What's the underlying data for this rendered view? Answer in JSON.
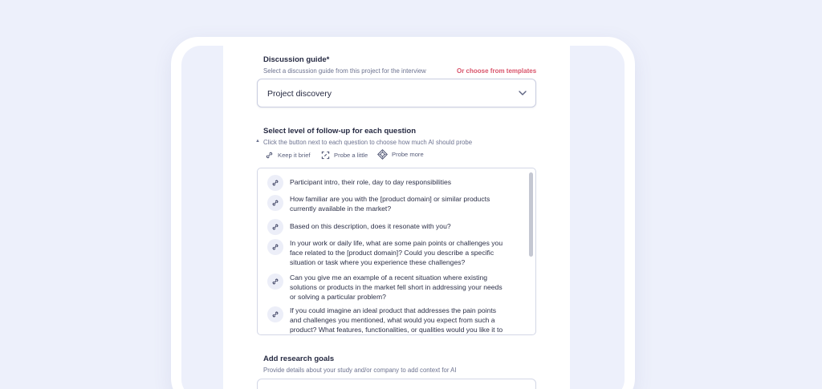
{
  "discussion_guide": {
    "label": "Discussion guide*",
    "hint": "Select a discussion guide from this project for the interview",
    "templates_link": "Or choose from templates",
    "selected": "Project discovery"
  },
  "followup": {
    "label": "Select level of follow-up for each question",
    "hint": "Click the button next to each question to choose how much AI should probe",
    "toggle_glyph": "▲",
    "levels": [
      {
        "label": "Keep it brief",
        "icon": "link-icon"
      },
      {
        "label": "Probe a little",
        "icon": "expand-icon"
      },
      {
        "label": "Probe more",
        "icon": "target-icon"
      }
    ]
  },
  "questions": [
    {
      "text": "Participant intro, their role, day to day responsibilities"
    },
    {
      "text": "How familiar are you with the [product domain] or similar products currently available in the market?"
    },
    {
      "text": "Based on this description, does it resonate with you?"
    },
    {
      "text": "In your work or daily life, what are some pain points or challenges you face related to the [product domain]? Could you describe a specific situation or task where you experience these challenges?"
    },
    {
      "text": "Can you give me an example of a recent situation where existing solutions or products in the market fell short in addressing your needs or solving a particular problem?"
    },
    {
      "text": "If you could imagine an ideal product that addresses the pain points and challenges you mentioned, what would you expect from such a product? What features, functionalities, or qualities would you like it to"
    }
  ],
  "research_goals": {
    "label": "Add research goals",
    "hint": "Provide details about your study and/or company to add context for AI"
  },
  "colors": {
    "background": "#edf0fb",
    "accent_link": "#d9536a",
    "text": "#262a42"
  }
}
